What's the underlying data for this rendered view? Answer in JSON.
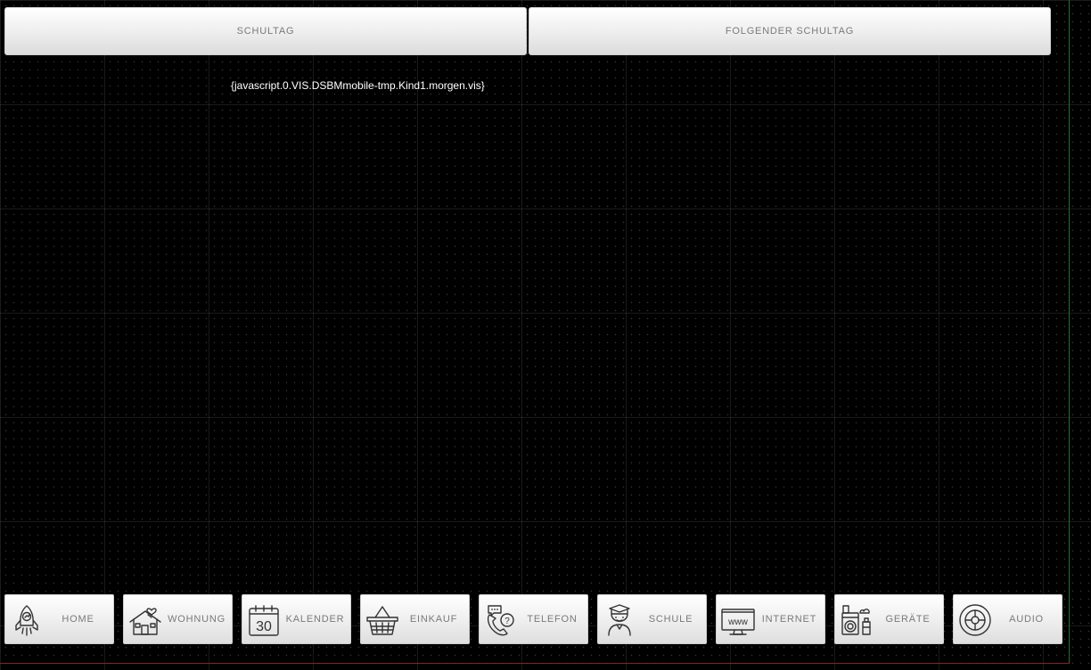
{
  "top_tabs": {
    "left_label": "SCHULTAG",
    "right_label": "FOLGENDER SCHULTAG"
  },
  "binding_placeholder": "{javascript.0.VIS.DSBMmobile-tmp.Kind1.morgen.vis}",
  "nav": {
    "items": [
      {
        "label": "HOME",
        "icon": "rocket-icon"
      },
      {
        "label": "WOHNUNG",
        "icon": "house-heart-icon"
      },
      {
        "label": "KALENDER",
        "icon": "calendar-icon"
      },
      {
        "label": "EINKAUF",
        "icon": "shopping-basket-icon"
      },
      {
        "label": "TELEFON",
        "icon": "phone-chat-icon"
      },
      {
        "label": "SCHULE",
        "icon": "student-icon"
      },
      {
        "label": "INTERNET",
        "icon": "www-monitor-icon"
      },
      {
        "label": "GERÄTE",
        "icon": "appliances-icon"
      },
      {
        "label": "AUDIO",
        "icon": "speaker-icon"
      }
    ],
    "calendar_day": "30",
    "www_text": "www"
  },
  "colors": {
    "background": "#000000",
    "button_face": "#eeeeee",
    "button_text": "#7a7a7a",
    "binding_text": "#ffffff"
  }
}
